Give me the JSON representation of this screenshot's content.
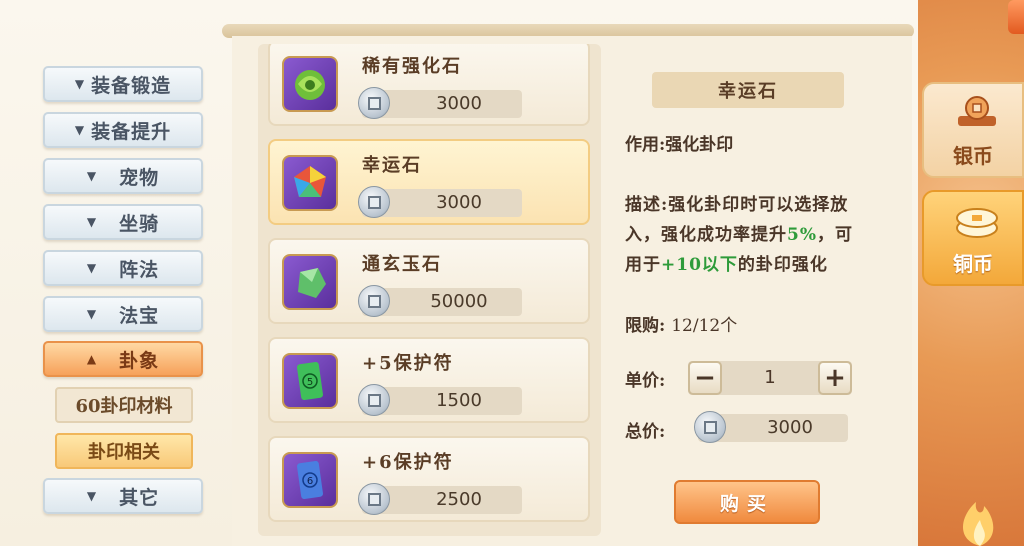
{
  "categories": [
    {
      "label": "装备锻造",
      "state": "collapsed"
    },
    {
      "label": "装备提升",
      "state": "collapsed"
    },
    {
      "label": "宠物",
      "state": "collapsed"
    },
    {
      "label": "坐骑",
      "state": "collapsed"
    },
    {
      "label": "阵法",
      "state": "collapsed"
    },
    {
      "label": "法宝",
      "state": "collapsed"
    },
    {
      "label": "卦象",
      "state": "expanded"
    },
    {
      "label": "其它",
      "state": "collapsed"
    }
  ],
  "subcategories": [
    {
      "label": "60卦印材料"
    },
    {
      "label": "卦印相关",
      "selected": true
    }
  ],
  "items": [
    {
      "name": "稀有强化石",
      "price": "3000",
      "icon": "rare-enhance-stone-icon"
    },
    {
      "name": "幸运石",
      "price": "3000",
      "icon": "lucky-stone-icon",
      "selected": true
    },
    {
      "name": "通玄玉石",
      "price": "50000",
      "icon": "tongxuan-jade-icon"
    },
    {
      "name": "+5保护符",
      "price": "1500",
      "icon": "protect-talisman-5-icon",
      "badge": "5"
    },
    {
      "name": "+6保护符",
      "price": "2500",
      "icon": "protect-talisman-6-icon",
      "badge": "6"
    }
  ],
  "detail": {
    "title": "幸运石",
    "effect": "作用:强化卦印",
    "desc_prefix": "描述:强化卦印时可以选择放入，强化成功率提升",
    "desc_pct": "5%",
    "desc_mid": "，可用于",
    "desc_range": "+10以下",
    "desc_suffix": "的卦印强化",
    "limit_label": "限购:",
    "limit_value": "12/12个",
    "unit_label": "单价:",
    "quantity": "1",
    "minus": "−",
    "plus": "+",
    "total_label": "总价:",
    "total": "3000",
    "buy_label": "购买"
  },
  "currency_tabs": [
    {
      "label": "银币",
      "active": false
    },
    {
      "label": "铜币",
      "active": true
    }
  ],
  "colors": {
    "accent": "#f08a3e",
    "highlight_green": "#2e9b3a"
  }
}
